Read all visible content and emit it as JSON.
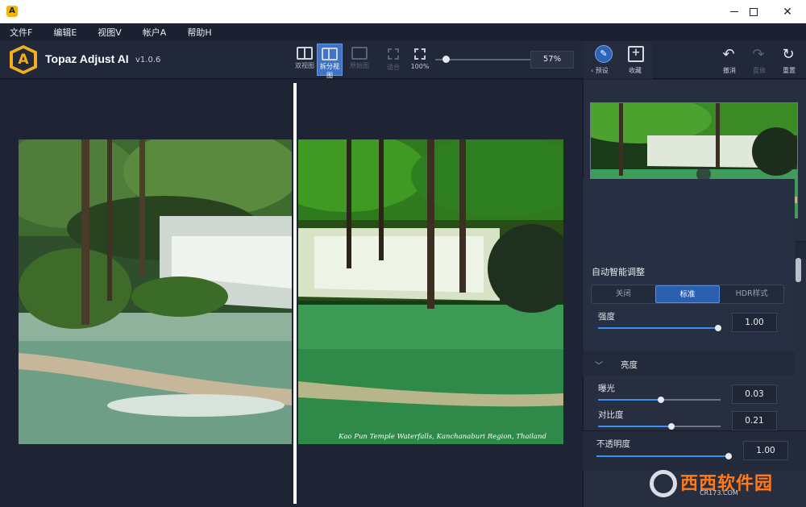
{
  "titlebar": {
    "app_icon_letter": "A"
  },
  "menu": [
    {
      "label": "文件F"
    },
    {
      "label": "编辑E"
    },
    {
      "label": "视图V"
    },
    {
      "label": "帐户A"
    },
    {
      "label": "帮助H"
    }
  ],
  "app": {
    "name": "Topaz Adjust AI",
    "version": "v1.0.6",
    "logo_letter": "A"
  },
  "view_modes": {
    "dual": "双视图",
    "split": "拆分视图",
    "original": "原始图",
    "active": "split"
  },
  "zoom": {
    "fit_label": "适合",
    "actual_label": "100%",
    "value_text": "57%",
    "value": 57
  },
  "right_toolbar": {
    "preset": "预设",
    "favorites": "收藏",
    "undo": "撤消",
    "redo": "重做",
    "reset": "重置"
  },
  "image": {
    "caption": "Kao Pun Temple Waterfalls, Kanchanaburi Region, Thailand"
  },
  "panel": {
    "auto_title": "自动智能调整",
    "modes": [
      "关闭",
      "标准",
      "HDR样式"
    ],
    "active_mode": "标准",
    "strength_label": "强度",
    "strength_value": "1.00",
    "brightness_title": "亮度",
    "exposure_label": "曝光",
    "exposure_value": "0.03",
    "contrast_label": "对比度",
    "contrast_value": "0.21",
    "opacity_label": "不透明度",
    "opacity_value": "1.00"
  },
  "watermark": {
    "brand": "西西软件园",
    "domain": "CR173.COM"
  },
  "colors": {
    "accent": "#2a5fb0",
    "logo": "#f2b01e",
    "background": "#1c2231",
    "panel": "#262e40"
  }
}
